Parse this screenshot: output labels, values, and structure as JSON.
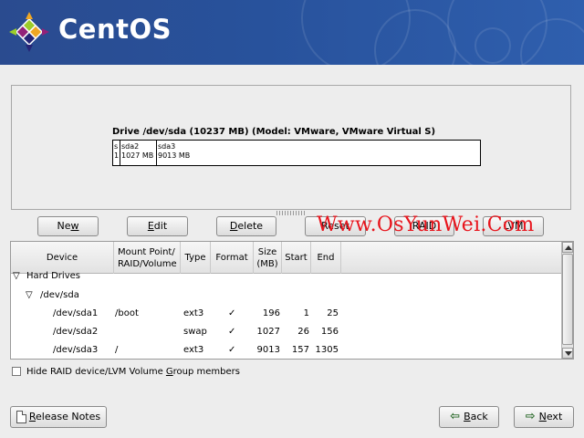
{
  "header": {
    "brand": "CentOS"
  },
  "drive": {
    "title": "Drive /dev/sda (10237 MB) (Model: VMware, VMware Virtual S)",
    "segments": [
      {
        "name": "s",
        "size": "1"
      },
      {
        "name": "sda2",
        "size": "1027 MB"
      },
      {
        "name": "sda3",
        "size": "9013 MB"
      }
    ]
  },
  "actions": {
    "new_pre": "Ne",
    "new_ul": "w",
    "new_post": "",
    "edit_pre": "",
    "edit_ul": "E",
    "edit_post": "dit",
    "delete_pre": "",
    "delete_ul": "D",
    "delete_post": "elete",
    "reset_label": "Reset",
    "raid_label": "RAID",
    "lvm_label": "LVM"
  },
  "watermark": "Www.OsYunWei.Com",
  "table": {
    "columns": {
      "device": "Device",
      "mount_l1": "Mount Point/",
      "mount_l2": "RAID/Volume",
      "type": "Type",
      "format": "Format",
      "size_l1": "Size",
      "size_l2": "(MB)",
      "start": "Start",
      "end": "End"
    },
    "group_label": "Hard Drives",
    "disk_label": "/dev/sda",
    "rows": [
      {
        "device": "/dev/sda1",
        "mount": "/boot",
        "type": "ext3",
        "format": "✓",
        "size": "196",
        "start": "1",
        "end": "25"
      },
      {
        "device": "/dev/sda2",
        "mount": "",
        "type": "swap",
        "format": "✓",
        "size": "1027",
        "start": "26",
        "end": "156"
      },
      {
        "device": "/dev/sda3",
        "mount": "/",
        "type": "ext3",
        "format": "✓",
        "size": "9013",
        "start": "157",
        "end": "1305"
      }
    ]
  },
  "options": {
    "hide_raid_pre": "Hide RAID device/LVM Volume ",
    "hide_raid_ul": "G",
    "hide_raid_post": "roup members",
    "hide_raid_checked": false
  },
  "footer": {
    "release_notes_ul": "R",
    "release_notes_post": "elease Notes",
    "back_ul": "B",
    "back_post": "ack",
    "next_ul": "N",
    "next_post": "ext"
  },
  "colors": {
    "header_bg": "#2a4b8f",
    "watermark": "#e8141c",
    "panel_bg": "#ededed"
  }
}
